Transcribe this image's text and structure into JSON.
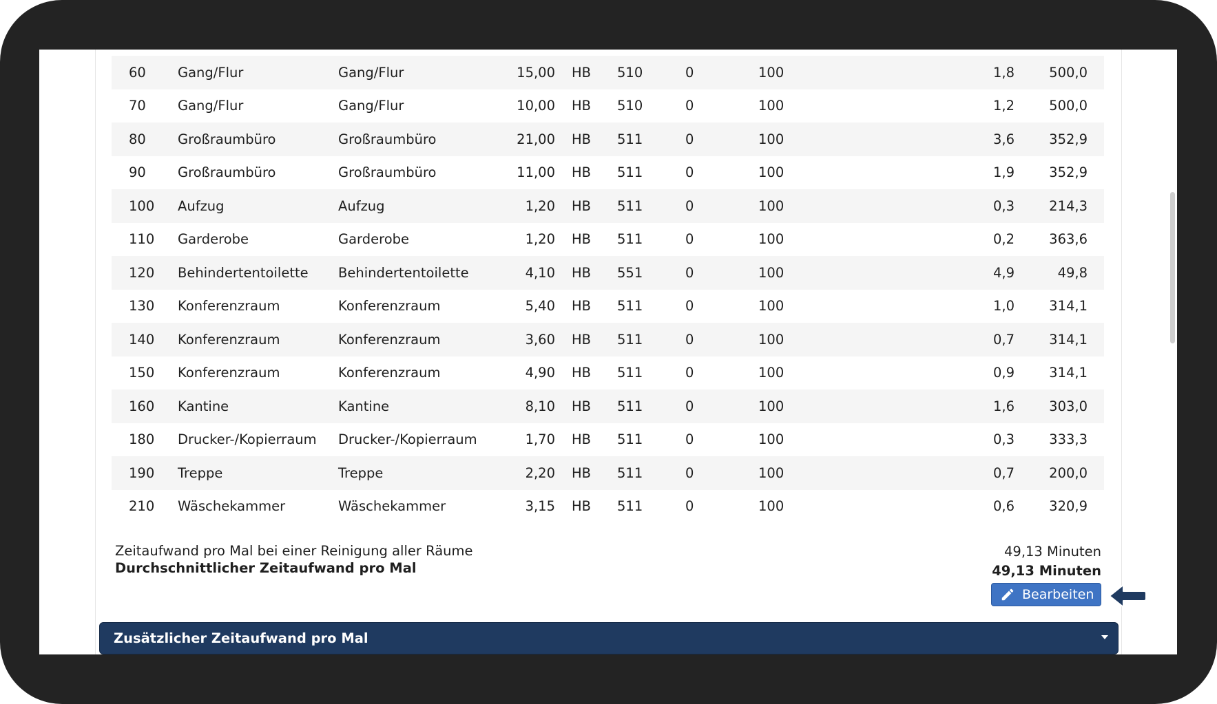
{
  "rooms": {
    "rows": [
      {
        "nr": "60",
        "name": "Gang/Flur",
        "typ": "Gang/Flur",
        "area": "15,00",
        "unit": "HB",
        "code": "510",
        "z": "0",
        "pct": "100",
        "t": "1,8",
        "perf": "500,0"
      },
      {
        "nr": "70",
        "name": "Gang/Flur",
        "typ": "Gang/Flur",
        "area": "10,00",
        "unit": "HB",
        "code": "510",
        "z": "0",
        "pct": "100",
        "t": "1,2",
        "perf": "500,0"
      },
      {
        "nr": "80",
        "name": "Großraumbüro",
        "typ": "Großraumbüro",
        "area": "21,00",
        "unit": "HB",
        "code": "511",
        "z": "0",
        "pct": "100",
        "t": "3,6",
        "perf": "352,9"
      },
      {
        "nr": "90",
        "name": "Großraumbüro",
        "typ": "Großraumbüro",
        "area": "11,00",
        "unit": "HB",
        "code": "511",
        "z": "0",
        "pct": "100",
        "t": "1,9",
        "perf": "352,9"
      },
      {
        "nr": "100",
        "name": "Aufzug",
        "typ": "Aufzug",
        "area": "1,20",
        "unit": "HB",
        "code": "511",
        "z": "0",
        "pct": "100",
        "t": "0,3",
        "perf": "214,3"
      },
      {
        "nr": "110",
        "name": "Garderobe",
        "typ": "Garderobe",
        "area": "1,20",
        "unit": "HB",
        "code": "511",
        "z": "0",
        "pct": "100",
        "t": "0,2",
        "perf": "363,6"
      },
      {
        "nr": "120",
        "name": "Behindertentoilette",
        "typ": "Behindertentoilette",
        "area": "4,10",
        "unit": "HB",
        "code": "551",
        "z": "0",
        "pct": "100",
        "t": "4,9",
        "perf": "49,8"
      },
      {
        "nr": "130",
        "name": "Konferenzraum",
        "typ": "Konferenzraum",
        "area": "5,40",
        "unit": "HB",
        "code": "511",
        "z": "0",
        "pct": "100",
        "t": "1,0",
        "perf": "314,1"
      },
      {
        "nr": "140",
        "name": "Konferenzraum",
        "typ": "Konferenzraum",
        "area": "3,60",
        "unit": "HB",
        "code": "511",
        "z": "0",
        "pct": "100",
        "t": "0,7",
        "perf": "314,1"
      },
      {
        "nr": "150",
        "name": "Konferenzraum",
        "typ": "Konferenzraum",
        "area": "4,90",
        "unit": "HB",
        "code": "511",
        "z": "0",
        "pct": "100",
        "t": "0,9",
        "perf": "314,1"
      },
      {
        "nr": "160",
        "name": "Kantine",
        "typ": "Kantine",
        "area": "8,10",
        "unit": "HB",
        "code": "511",
        "z": "0",
        "pct": "100",
        "t": "1,6",
        "perf": "303,0"
      },
      {
        "nr": "180",
        "name": "Drucker-/Kopierraum",
        "typ": "Drucker-/Kopierraum",
        "area": "1,70",
        "unit": "HB",
        "code": "511",
        "z": "0",
        "pct": "100",
        "t": "0,3",
        "perf": "333,3"
      },
      {
        "nr": "190",
        "name": "Treppe",
        "typ": "Treppe",
        "area": "2,20",
        "unit": "HB",
        "code": "511",
        "z": "0",
        "pct": "100",
        "t": "0,7",
        "perf": "200,0"
      },
      {
        "nr": "210",
        "name": "Wäschekammer",
        "typ": "Wäschekammer",
        "area": "3,15",
        "unit": "HB",
        "code": "511",
        "z": "0",
        "pct": "100",
        "t": "0,6",
        "perf": "320,9"
      }
    ]
  },
  "summary": {
    "total_label": "Zeitaufwand pro Mal bei einer Reinigung aller Räume",
    "total_value": "49,13 Minuten",
    "avg_label": "Durchschnittlicher Zeitaufwand pro Mal",
    "avg_value": "49,13 Minuten"
  },
  "edit_button": {
    "label": "Bearbeiten",
    "icon": "pencil-icon",
    "color": "#3f74c4"
  },
  "arrow_hint": {
    "icon": "arrow-left-icon",
    "color": "#1f3a60"
  },
  "accordion": {
    "label": "Zusätzlicher Zeitaufwand pro Mal",
    "icon": "caret-down-icon",
    "color": "#1f3a60"
  }
}
